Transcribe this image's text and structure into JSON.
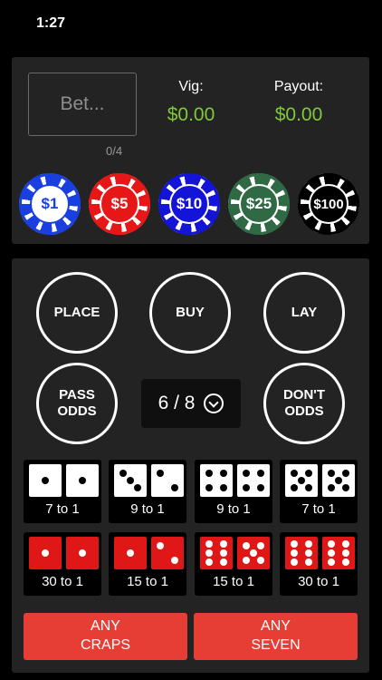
{
  "status_bar": {
    "time": "1:27"
  },
  "bet": {
    "placeholder": "Bet...",
    "count": "0/4"
  },
  "vig": {
    "label": "Vig:",
    "value": "$0.00"
  },
  "payout": {
    "label": "Payout:",
    "value": "$0.00"
  },
  "chips": [
    {
      "label": "$1",
      "color": "#1a3fe0",
      "style": "white"
    },
    {
      "label": "$5",
      "color": "#e81717",
      "style": "red"
    },
    {
      "label": "$10",
      "color": "#1414d8",
      "style": "blue"
    },
    {
      "label": "$25",
      "color": "#2f6a45",
      "style": "green"
    },
    {
      "label": "$100",
      "color": "#000000",
      "style": "black"
    }
  ],
  "buttons": {
    "place": "PLACE",
    "buy": "BUY",
    "lay": "LAY",
    "pass_odds": "PASS\nODDS",
    "dont_odds": "DON'T\nODDS"
  },
  "point_selector": {
    "value": "6 / 8"
  },
  "dice_bets": [
    {
      "dice": [
        1,
        1
      ],
      "color": "white",
      "label": "7 to 1"
    },
    {
      "dice": [
        3,
        2
      ],
      "color": "white",
      "label": "9 to 1"
    },
    {
      "dice": [
        4,
        4
      ],
      "color": "white",
      "label": "9 to 1"
    },
    {
      "dice": [
        5,
        5
      ],
      "color": "white",
      "label": "7 to 1"
    },
    {
      "dice": [
        1,
        1
      ],
      "color": "red",
      "label": "30 to 1"
    },
    {
      "dice": [
        1,
        2
      ],
      "color": "red",
      "label": "15 to 1"
    },
    {
      "dice": [
        6,
        5
      ],
      "color": "red",
      "label": "15 to 1"
    },
    {
      "dice": [
        6,
        6
      ],
      "color": "red",
      "label": "30 to 1"
    }
  ],
  "any_craps": "ANY\nCRAPS",
  "any_seven": "ANY\nSEVEN",
  "colors": {
    "money": "#7fc93a",
    "panel": "#232323",
    "action_red": "#e63e35"
  }
}
